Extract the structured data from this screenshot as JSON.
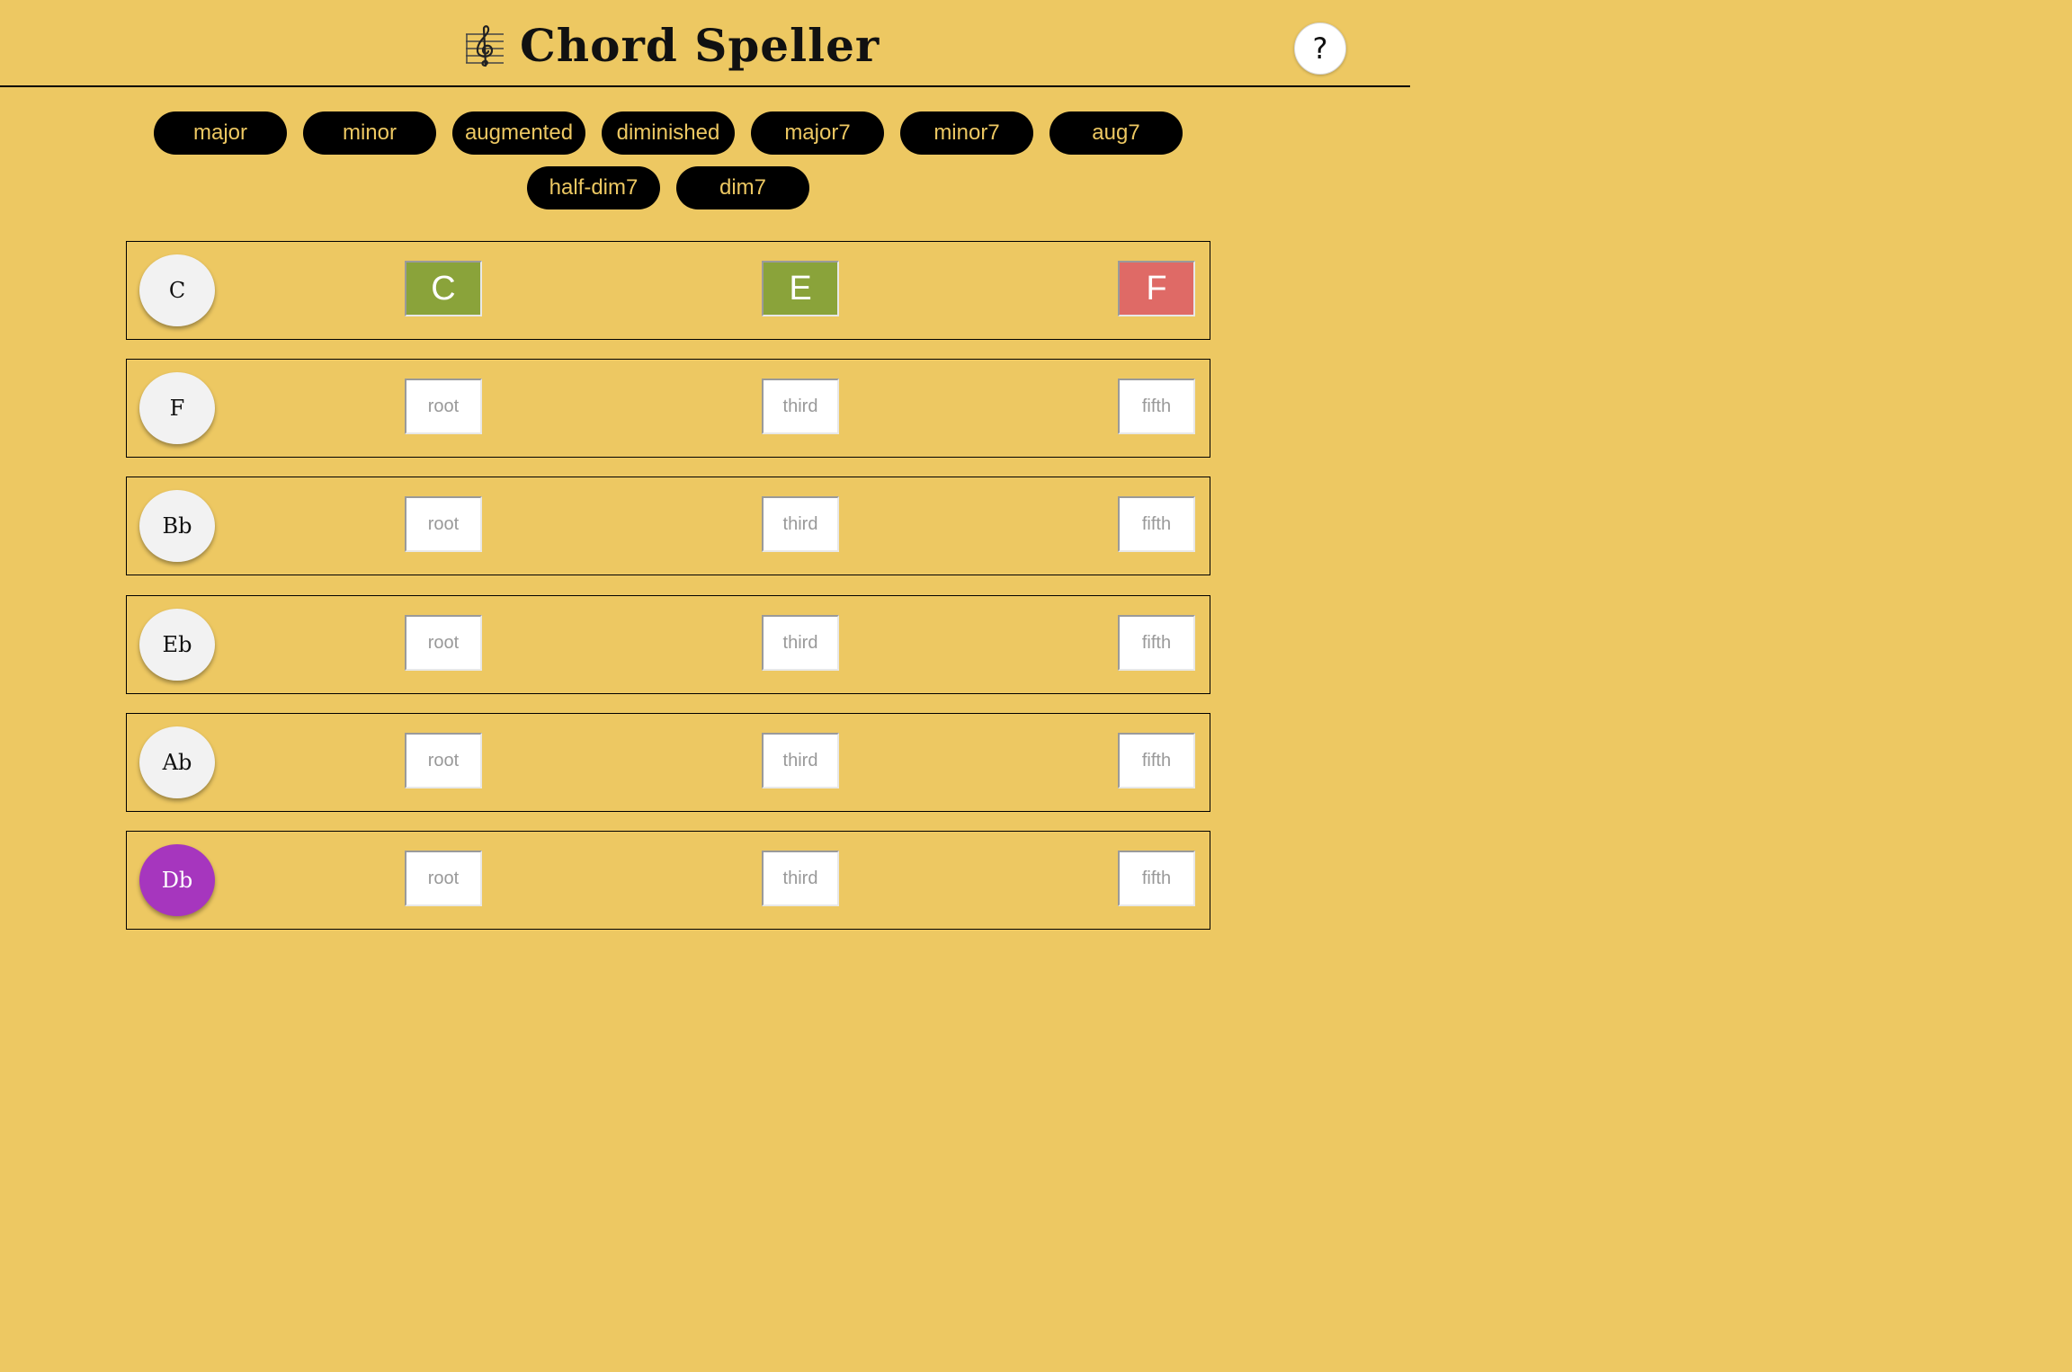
{
  "header": {
    "title": "Chord Speller",
    "help_label": "?"
  },
  "chord_types": [
    "major",
    "minor",
    "augmented",
    "diminished",
    "major7",
    "minor7",
    "aug7",
    "half-dim7",
    "dim7"
  ],
  "rows": [
    {
      "note": "C",
      "slots": {
        "root": "C",
        "third": "E",
        "fifth": "F"
      },
      "status": {
        "root": "correct",
        "third": "correct",
        "fifth": "wrong"
      }
    },
    {
      "note": "F",
      "slots": {
        "root": "root",
        "third": "third",
        "fifth": "fifth"
      }
    },
    {
      "note": "Bb",
      "slots": {
        "root": "root",
        "third": "third",
        "fifth": "fifth"
      }
    },
    {
      "note": "Eb",
      "slots": {
        "root": "root",
        "third": "third",
        "fifth": "fifth"
      }
    },
    {
      "note": "Ab",
      "slots": {
        "root": "root",
        "third": "third",
        "fifth": "fifth"
      }
    },
    {
      "note": "Db",
      "slots": {
        "root": "root",
        "third": "third",
        "fifth": "fifth"
      },
      "active": true
    }
  ],
  "colors": {
    "background": "#EDC862",
    "correct": "#8AA33A",
    "wrong": "#DF6A66",
    "active_note": "#A636BE"
  }
}
